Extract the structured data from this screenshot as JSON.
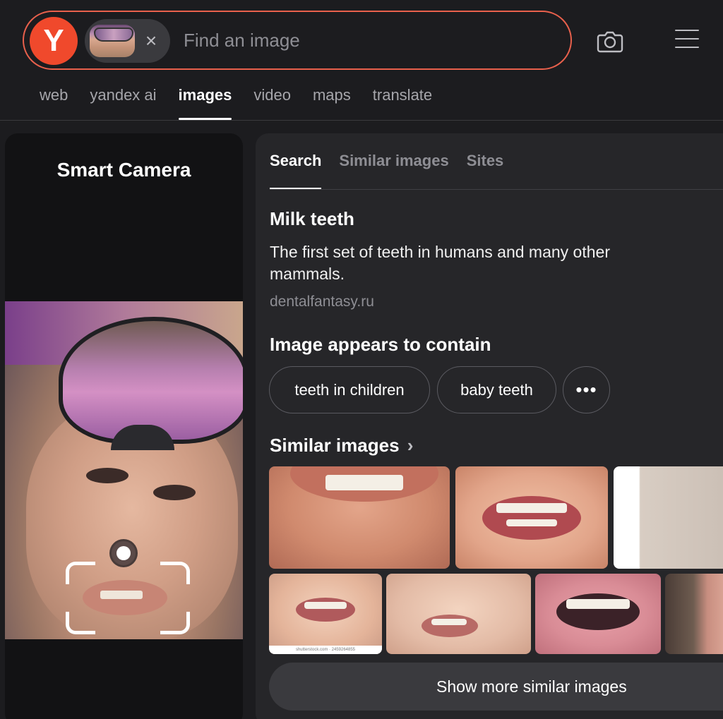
{
  "header": {
    "logo_letter": "Y",
    "search_placeholder": "Find an image",
    "chip_close": "×",
    "camera_icon": "camera-icon",
    "menu_icon": "hamburger-menu-icon"
  },
  "nav": {
    "items": [
      {
        "label": "web",
        "active": false
      },
      {
        "label": "yandex ai",
        "active": false
      },
      {
        "label": "images",
        "active": true
      },
      {
        "label": "video",
        "active": false
      },
      {
        "label": "maps",
        "active": false
      },
      {
        "label": "translate",
        "active": false
      }
    ]
  },
  "smart_camera": {
    "title": "Smart Camera"
  },
  "results": {
    "tabs": [
      {
        "label": "Search",
        "active": true
      },
      {
        "label": "Similar images",
        "active": false
      },
      {
        "label": "Sites",
        "active": false
      }
    ],
    "entity": {
      "title": "Milk teeth",
      "description": "The first set of teeth in humans and many other mammals.",
      "source": "dentalfantasy.ru"
    },
    "contains": {
      "title": "Image appears to contain",
      "tags": [
        "teeth in children",
        "baby teeth"
      ],
      "more": "•••"
    },
    "similar": {
      "title": "Similar images",
      "chevron": "›",
      "watermark": "shutterstock.com · 2459264855",
      "button": "Show more similar images"
    }
  },
  "colors": {
    "background": "#1c1c1f",
    "panel": "#262629",
    "accent": "#f0492c",
    "search_border": "#e8604c"
  }
}
